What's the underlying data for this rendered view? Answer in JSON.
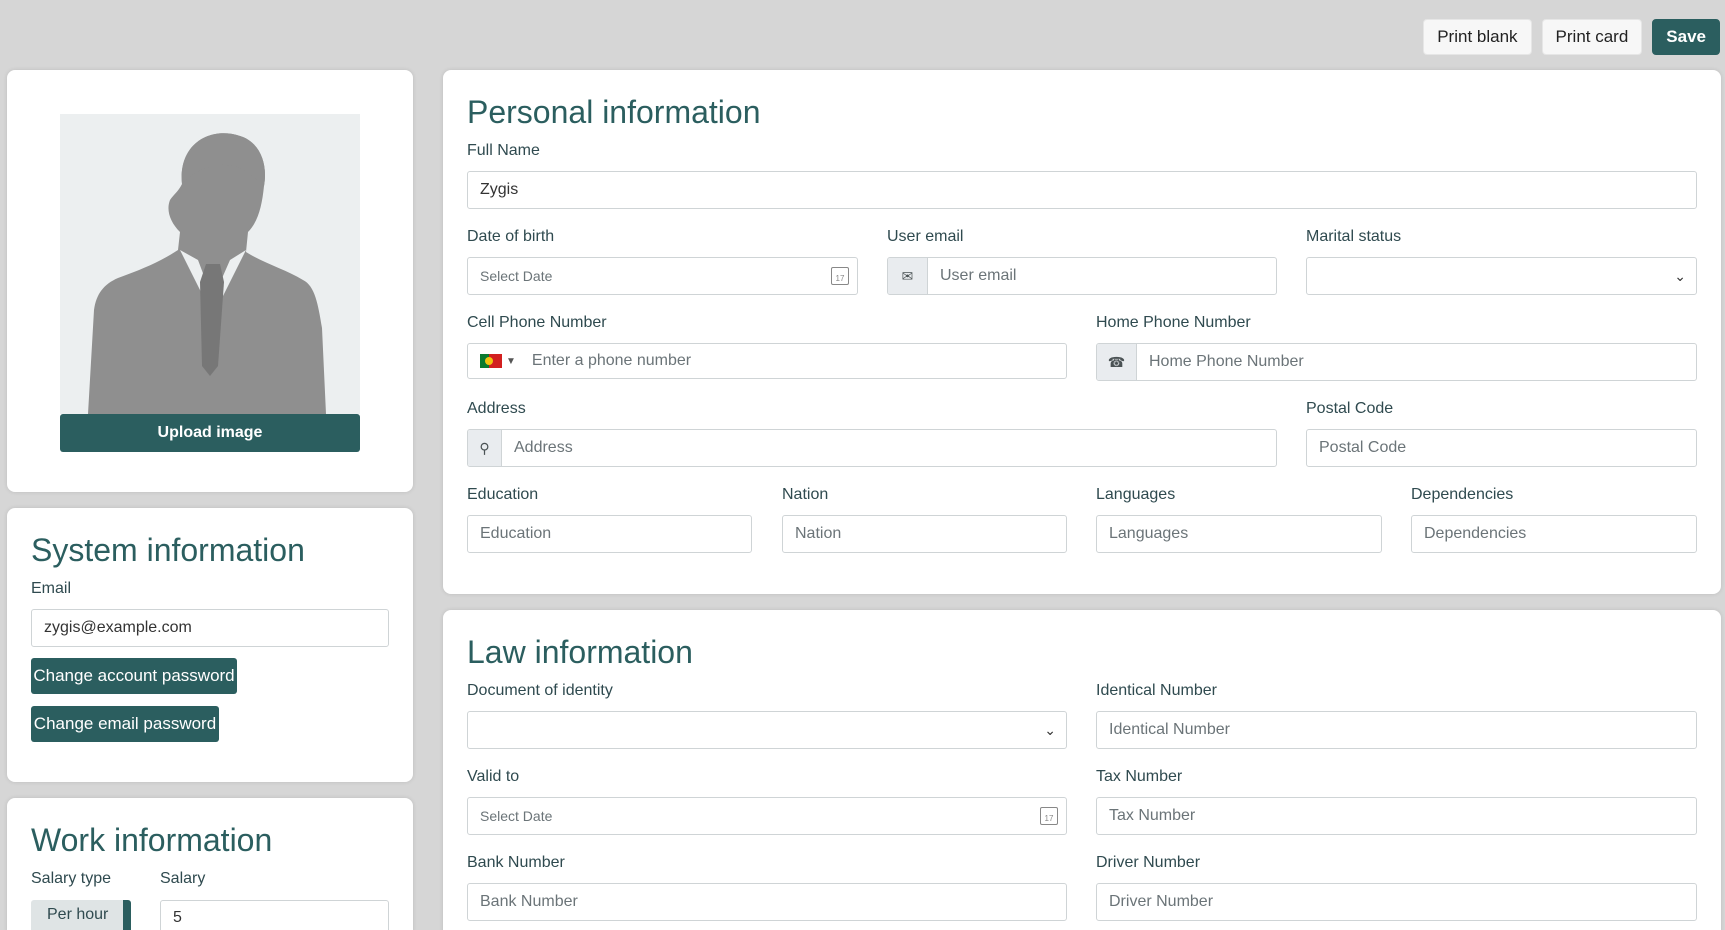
{
  "toolbar": {
    "print_blank": "Print blank",
    "print_card": "Print card",
    "save": "Save"
  },
  "photo": {
    "upload_label": "Upload image"
  },
  "system": {
    "title": "System information",
    "email_label": "Email",
    "email_value": "zygis@example.com",
    "change_account_password": "Change account password",
    "change_email_password": "Change email password"
  },
  "work": {
    "title": "Work information",
    "salary_type_label": "Salary type",
    "salary_label": "Salary",
    "salary_type_value": "Per hour",
    "salary_value": "5"
  },
  "personal": {
    "title": "Personal information",
    "full_name_label": "Full Name",
    "full_name_value": "Zygis",
    "dob_label": "Date of birth",
    "dob_placeholder": "Select Date",
    "user_email_label": "User email",
    "user_email_placeholder": "User email",
    "marital_label": "Marital status",
    "cell_label": "Cell Phone Number",
    "cell_placeholder": "Enter a phone number",
    "home_label": "Home Phone Number",
    "home_placeholder": "Home Phone Number",
    "address_label": "Address",
    "address_placeholder": "Address",
    "postal_label": "Postal Code",
    "postal_placeholder": "Postal Code",
    "education_label": "Education",
    "education_placeholder": "Education",
    "nation_label": "Nation",
    "nation_placeholder": "Nation",
    "languages_label": "Languages",
    "languages_placeholder": "Languages",
    "dependencies_label": "Dependencies",
    "dependencies_placeholder": "Dependencies"
  },
  "law": {
    "title": "Law information",
    "doc_label": "Document of identity",
    "ident_label": "Identical Number",
    "ident_placeholder": "Identical Number",
    "valid_label": "Valid to",
    "valid_placeholder": "Select Date",
    "tax_label": "Tax Number",
    "tax_placeholder": "Tax Number",
    "bank_label": "Bank Number",
    "bank_placeholder": "Bank Number",
    "driver_label": "Driver Number",
    "driver_placeholder": "Driver Number"
  },
  "colors": {
    "accent": "#2b5e5f",
    "background": "#d6d6d6"
  },
  "icons": [
    "avatar-silhouette",
    "calendar-icon",
    "envelope-icon",
    "phone-icon",
    "map-pin-icon",
    "chevron-down-icon",
    "portugal-flag-icon",
    "caret-down-icon"
  ]
}
